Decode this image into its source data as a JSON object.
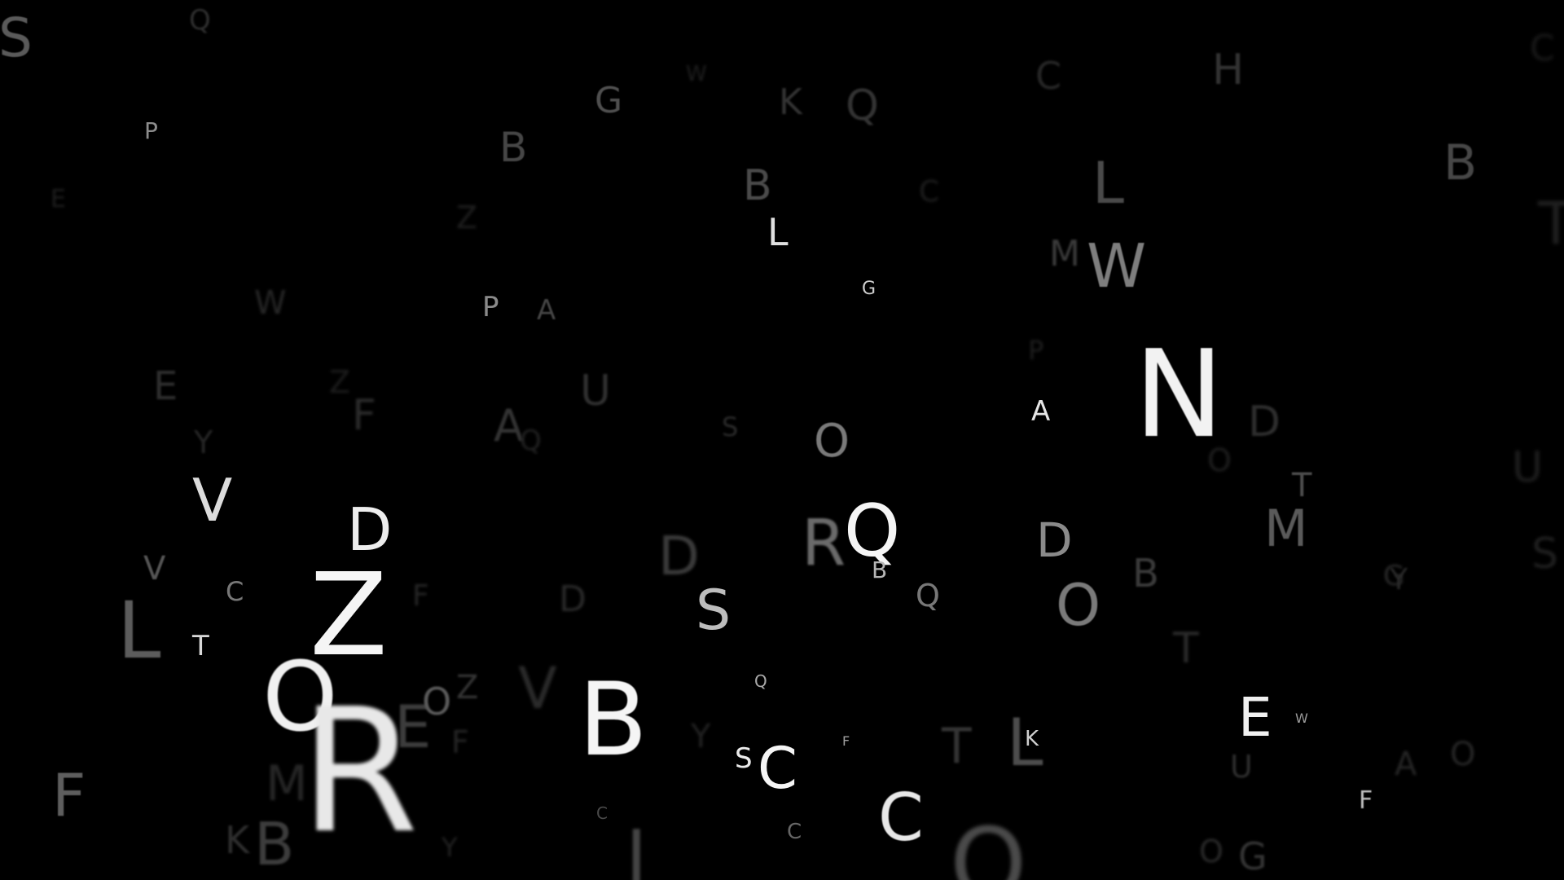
{
  "scene": {
    "background": "#000000",
    "glyphs": [
      {
        "id": "letter-S",
        "text": "S"
      },
      {
        "id": "letter-Q",
        "text": "Q"
      },
      {
        "id": "letter-P",
        "text": "P"
      },
      {
        "id": "letter-G",
        "text": "G"
      },
      {
        "id": "letter-B",
        "text": "B"
      },
      {
        "id": "letter-K",
        "text": "K"
      },
      {
        "id": "letter-Q",
        "text": "Q"
      },
      {
        "id": "letter-C",
        "text": "C"
      },
      {
        "id": "letter-H",
        "text": "H"
      },
      {
        "id": "letter-B",
        "text": "B"
      },
      {
        "id": "letter-B",
        "text": "B"
      },
      {
        "id": "letter-L",
        "text": "L"
      },
      {
        "id": "letter-L",
        "text": "L"
      },
      {
        "id": "letter-M",
        "text": "M"
      },
      {
        "id": "letter-W",
        "text": "W"
      },
      {
        "id": "letter-G",
        "text": "G"
      },
      {
        "id": "letter-P",
        "text": "P"
      },
      {
        "id": "letter-A",
        "text": "A"
      },
      {
        "id": "letter-W",
        "text": "W"
      },
      {
        "id": "letter-E",
        "text": "E"
      },
      {
        "id": "letter-F",
        "text": "F"
      },
      {
        "id": "letter-U",
        "text": "U"
      },
      {
        "id": "letter-A",
        "text": "A"
      },
      {
        "id": "letter-O",
        "text": "O"
      },
      {
        "id": "letter-A",
        "text": "A"
      },
      {
        "id": "letter-N",
        "text": "N"
      },
      {
        "id": "letter-D",
        "text": "D"
      },
      {
        "id": "letter-V",
        "text": "V"
      },
      {
        "id": "letter-D",
        "text": "D"
      },
      {
        "id": "letter-Z",
        "text": "Z"
      },
      {
        "id": "letter-R",
        "text": "R"
      },
      {
        "id": "letter-Q",
        "text": "Q"
      },
      {
        "id": "letter-B",
        "text": "B"
      },
      {
        "id": "letter-D",
        "text": "D"
      },
      {
        "id": "letter-T",
        "text": "T"
      },
      {
        "id": "letter-M",
        "text": "M"
      },
      {
        "id": "letter-V",
        "text": "V"
      },
      {
        "id": "letter-C",
        "text": "C"
      },
      {
        "id": "letter-L",
        "text": "L"
      },
      {
        "id": "letter-T",
        "text": "T"
      },
      {
        "id": "letter-O",
        "text": "O"
      },
      {
        "id": "letter-S",
        "text": "S"
      },
      {
        "id": "letter-Q",
        "text": "Q"
      },
      {
        "id": "letter-O",
        "text": "O"
      },
      {
        "id": "letter-B",
        "text": "B"
      },
      {
        "id": "letter-T",
        "text": "T"
      },
      {
        "id": "letter-E",
        "text": "E"
      },
      {
        "id": "letter-W",
        "text": "W"
      },
      {
        "id": "letter-R",
        "text": "R"
      },
      {
        "id": "letter-E",
        "text": "E"
      },
      {
        "id": "letter-O",
        "text": "O"
      },
      {
        "id": "letter-Z",
        "text": "Z"
      },
      {
        "id": "letter-B",
        "text": "B"
      },
      {
        "id": "letter-Q",
        "text": "Q"
      },
      {
        "id": "letter-S",
        "text": "S"
      },
      {
        "id": "letter-C",
        "text": "C"
      },
      {
        "id": "letter-F",
        "text": "F"
      },
      {
        "id": "letter-C",
        "text": "C"
      },
      {
        "id": "letter-T",
        "text": "T"
      },
      {
        "id": "letter-L",
        "text": "L"
      },
      {
        "id": "letter-K",
        "text": "K"
      },
      {
        "id": "letter-F",
        "text": "F"
      },
      {
        "id": "letter-K",
        "text": "K"
      },
      {
        "id": "letter-B",
        "text": "B"
      },
      {
        "id": "letter-M",
        "text": "M"
      },
      {
        "id": "letter-V",
        "text": "V"
      },
      {
        "id": "letter-I",
        "text": "I"
      },
      {
        "id": "letter-C",
        "text": "C"
      },
      {
        "id": "letter-U",
        "text": "U"
      },
      {
        "id": "letter-G",
        "text": "G"
      },
      {
        "id": "letter-F",
        "text": "F"
      },
      {
        "id": "letter-A",
        "text": "A"
      },
      {
        "id": "letter-O",
        "text": "O"
      },
      {
        "id": "letter-Y",
        "text": "Y"
      },
      {
        "id": "letter-Z",
        "text": "Z"
      },
      {
        "id": "letter-U",
        "text": "U"
      },
      {
        "id": "letter-D",
        "text": "D"
      },
      {
        "id": "letter-O",
        "text": "O"
      },
      {
        "id": "letter-S",
        "text": "S"
      },
      {
        "id": "letter-Y",
        "text": "Y"
      },
      {
        "id": "letter-Y",
        "text": "Y"
      },
      {
        "id": "letter-D",
        "text": "D"
      },
      {
        "id": "letter-C",
        "text": "C"
      },
      {
        "id": "letter-F",
        "text": "F"
      },
      {
        "id": "letter-Z",
        "text": "Z"
      },
      {
        "id": "letter-O",
        "text": "O"
      },
      {
        "id": "letter-S",
        "text": "S"
      },
      {
        "id": "letter-G",
        "text": "G"
      },
      {
        "id": "letter-E",
        "text": "E"
      },
      {
        "id": "letter-P",
        "text": "P"
      },
      {
        "id": "letter-T",
        "text": "T"
      },
      {
        "id": "letter-Y",
        "text": "Y"
      },
      {
        "id": "letter-C",
        "text": "C"
      },
      {
        "id": "letter-C",
        "text": "C"
      },
      {
        "id": "letter-Q",
        "text": "Q"
      },
      {
        "id": "letter-W",
        "text": "W"
      },
      {
        "id": "letter-F",
        "text": "F"
      },
      {
        "id": "letter-O",
        "text": "O"
      }
    ]
  }
}
